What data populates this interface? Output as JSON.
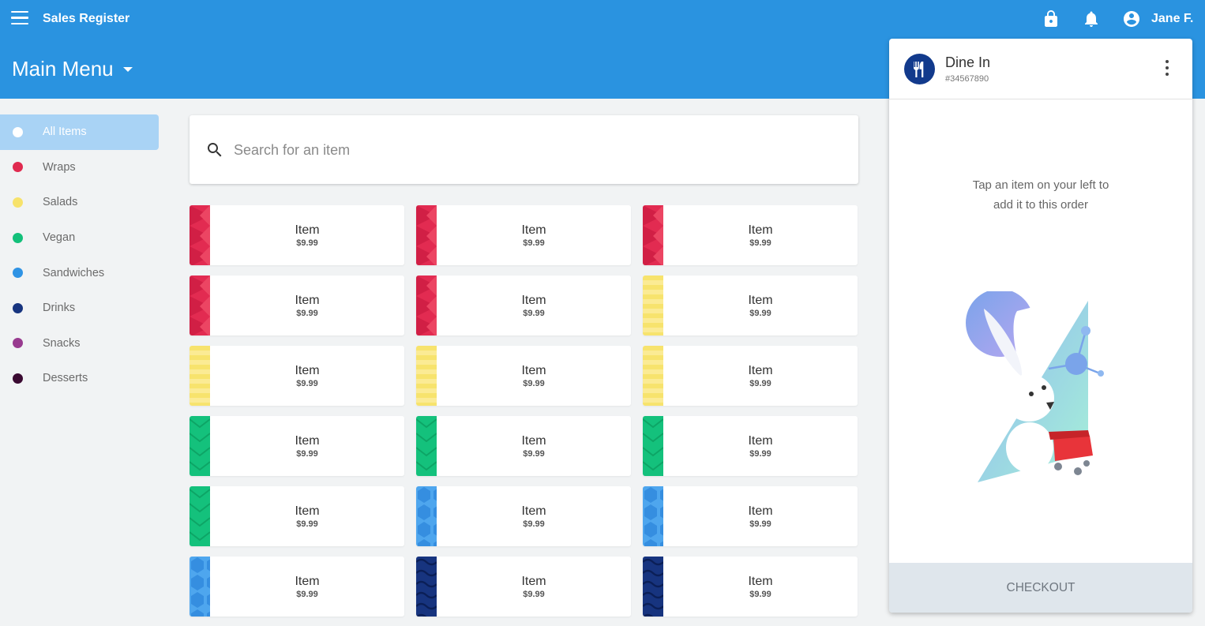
{
  "app": {
    "title": "Sales Register",
    "user_name": "Jane F."
  },
  "header": {
    "menu_title": "Main Menu"
  },
  "icons": {
    "menu": "hamburger-icon",
    "lock": "lock-icon",
    "notifications": "bell-icon",
    "account": "account-circle-icon",
    "search": "search-icon",
    "order_type": "restaurant-icon",
    "more": "more-vert-icon"
  },
  "colors": {
    "primary": "#2a93e0",
    "accent_dark": "#123a8c"
  },
  "categories": [
    {
      "label": "All Items",
      "color": "#ffffff",
      "active": true
    },
    {
      "label": "Wraps",
      "color": "#e02a4f",
      "active": false
    },
    {
      "label": "Salads",
      "color": "#f7e26b",
      "active": false
    },
    {
      "label": "Vegan",
      "color": "#13c07a",
      "active": false
    },
    {
      "label": "Sandwiches",
      "color": "#2f93e4",
      "active": false
    },
    {
      "label": "Drinks",
      "color": "#17347f",
      "active": false
    },
    {
      "label": "Snacks",
      "color": "#983a8f",
      "active": false
    },
    {
      "label": "Desserts",
      "color": "#3a0a31",
      "active": false
    }
  ],
  "search": {
    "placeholder": "Search for an item",
    "value": ""
  },
  "items": [
    {
      "name": "Item",
      "price": "$9.99",
      "category": "wraps"
    },
    {
      "name": "Item",
      "price": "$9.99",
      "category": "wraps"
    },
    {
      "name": "Item",
      "price": "$9.99",
      "category": "wraps"
    },
    {
      "name": "Item",
      "price": "$9.99",
      "category": "wraps"
    },
    {
      "name": "Item",
      "price": "$9.99",
      "category": "wraps"
    },
    {
      "name": "Item",
      "price": "$9.99",
      "category": "salads"
    },
    {
      "name": "Item",
      "price": "$9.99",
      "category": "salads"
    },
    {
      "name": "Item",
      "price": "$9.99",
      "category": "salads"
    },
    {
      "name": "Item",
      "price": "$9.99",
      "category": "salads"
    },
    {
      "name": "Item",
      "price": "$9.99",
      "category": "vegan"
    },
    {
      "name": "Item",
      "price": "$9.99",
      "category": "vegan"
    },
    {
      "name": "Item",
      "price": "$9.99",
      "category": "vegan"
    },
    {
      "name": "Item",
      "price": "$9.99",
      "category": "vegan"
    },
    {
      "name": "Item",
      "price": "$9.99",
      "category": "sandwiches"
    },
    {
      "name": "Item",
      "price": "$9.99",
      "category": "sandwiches"
    },
    {
      "name": "Item",
      "price": "$9.99",
      "category": "sandwiches"
    },
    {
      "name": "Item",
      "price": "$9.99",
      "category": "drinks"
    },
    {
      "name": "Item",
      "price": "$9.99",
      "category": "drinks"
    }
  ],
  "order": {
    "type": "Dine In",
    "number": "#34567890",
    "empty_message_line1": "Tap an item on your left to",
    "empty_message_line2": "add it to this order",
    "checkout_label": "CHECKOUT"
  }
}
